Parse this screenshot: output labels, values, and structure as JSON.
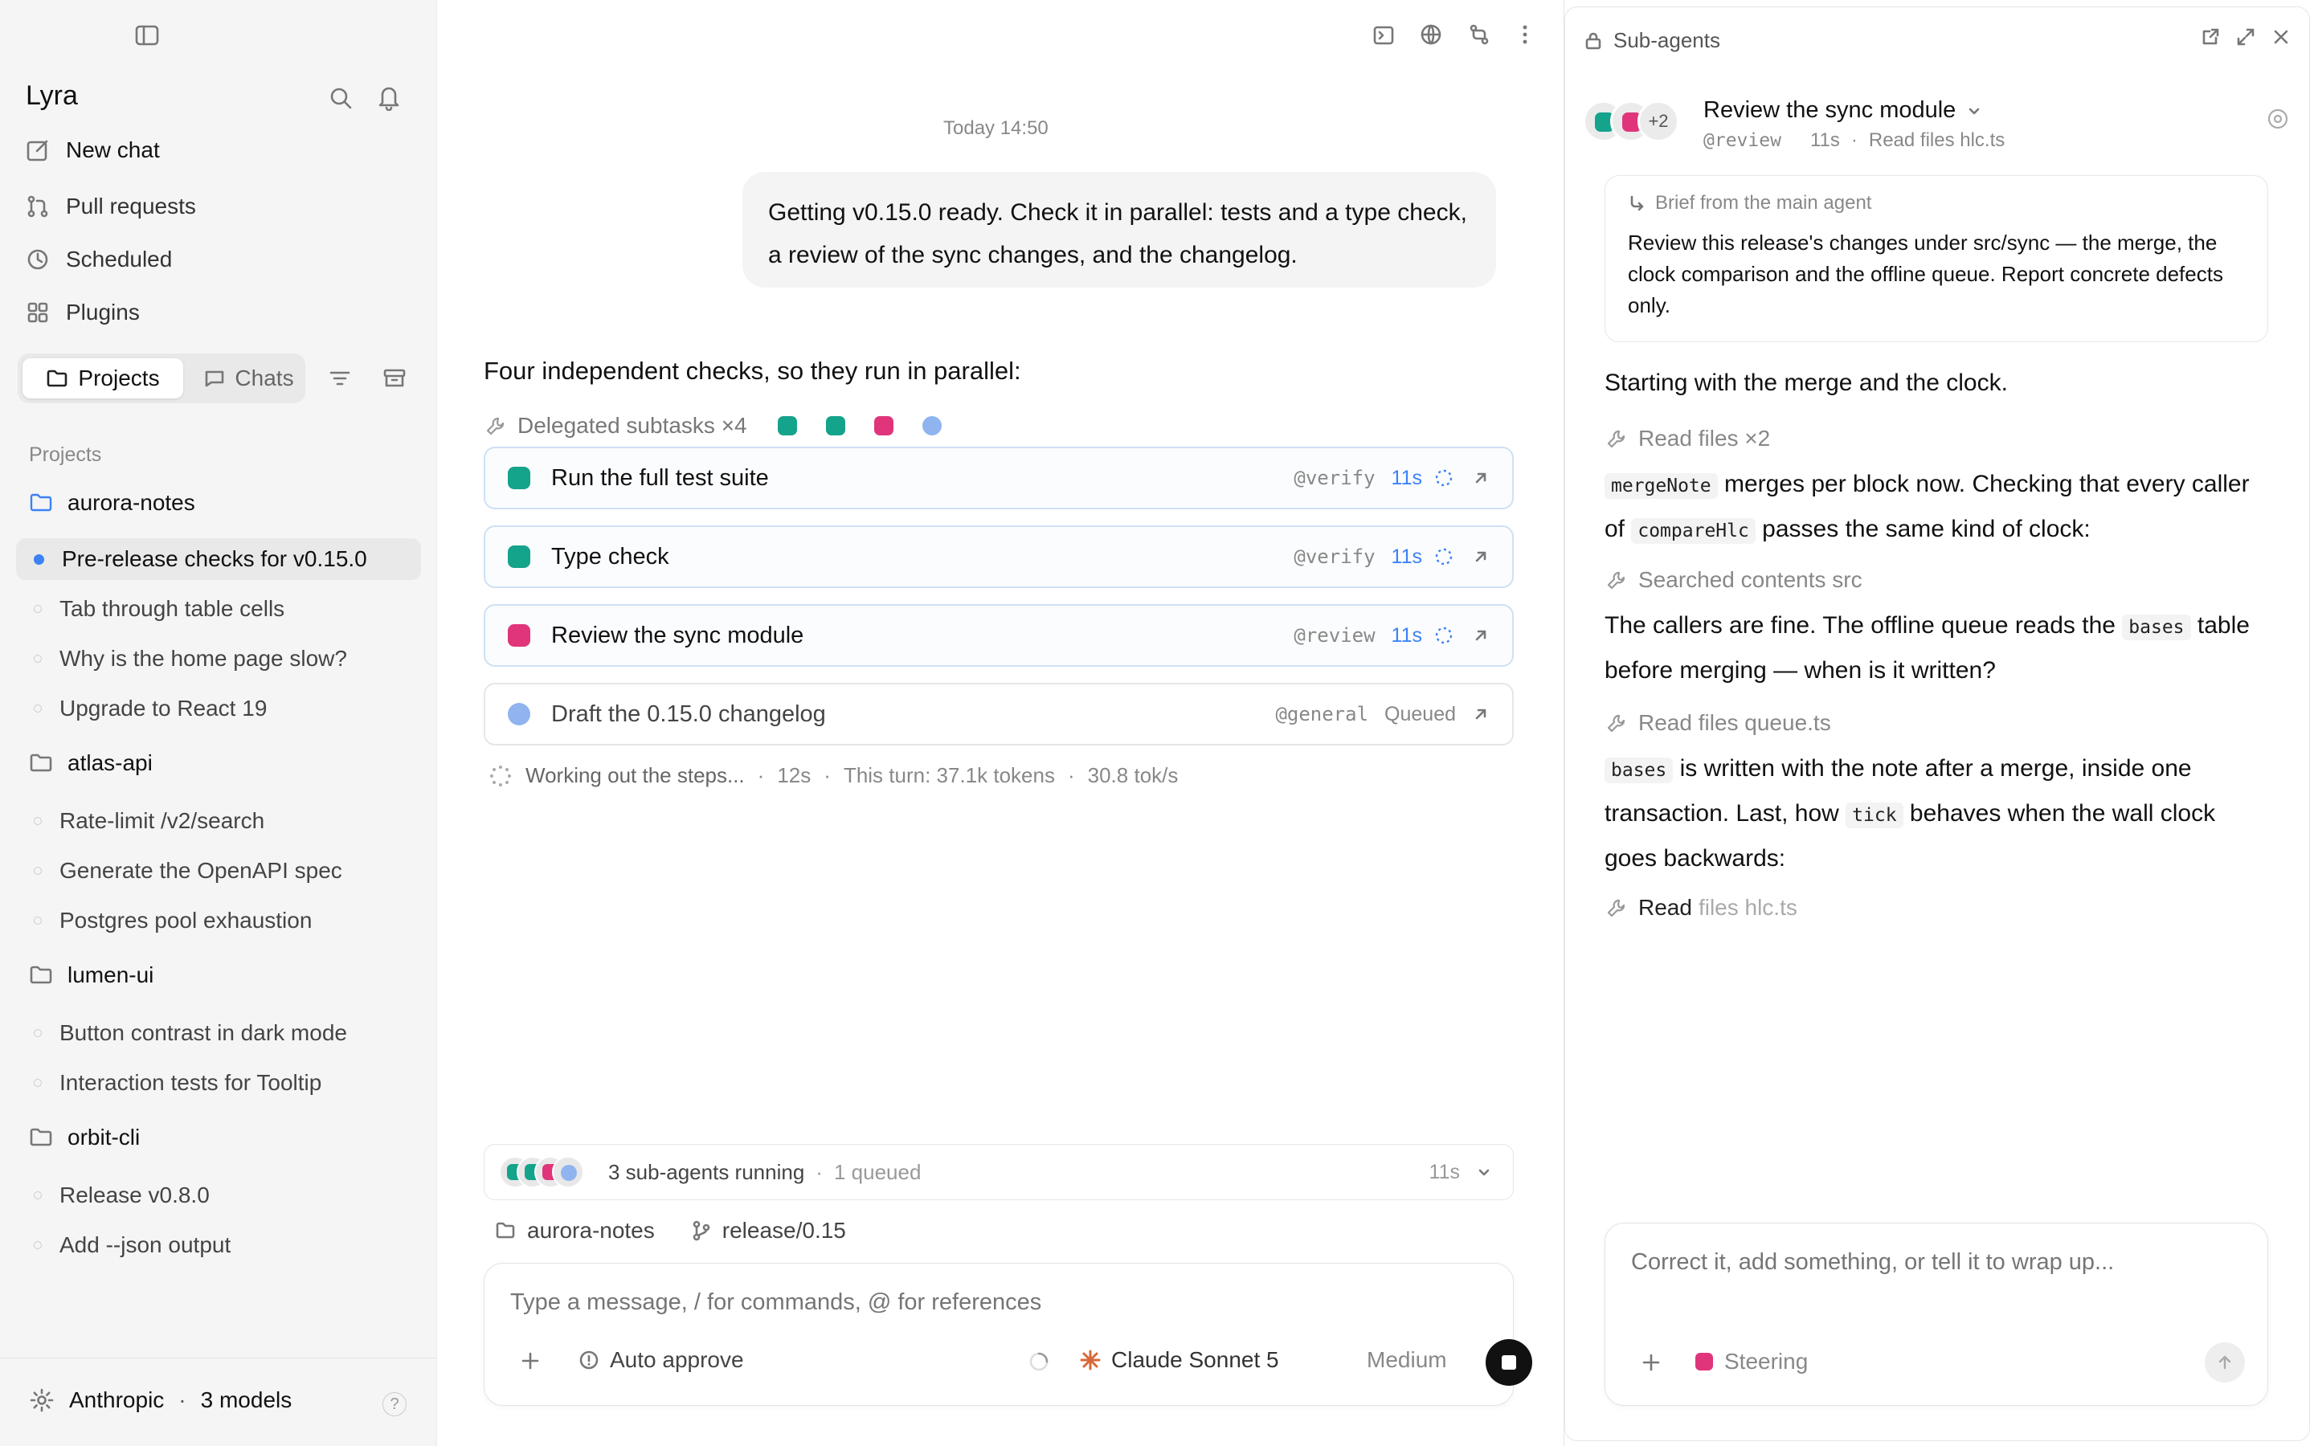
{
  "sidebar": {
    "brand": "Lyra",
    "nav": [
      {
        "label": "New chat",
        "icon": "edit-icon"
      },
      {
        "label": "Pull requests",
        "icon": "pull-request-icon"
      },
      {
        "label": "Scheduled",
        "icon": "clock-icon"
      },
      {
        "label": "Plugins",
        "icon": "plugins-icon"
      }
    ],
    "tabs": {
      "projects": "Projects",
      "chats": "Chats",
      "active": "Projects"
    },
    "section_label": "Projects",
    "projects": [
      {
        "name": "aurora-notes",
        "chats": [
          "Pre-release checks for v0.15.0",
          "Tab through table cells",
          "Why is the home page slow?",
          "Upgrade to React 19"
        ]
      },
      {
        "name": "atlas-api",
        "chats": [
          "Rate-limit /v2/search",
          "Generate the OpenAPI spec",
          "Postgres pool exhaustion"
        ]
      },
      {
        "name": "lumen-ui",
        "chats": [
          "Button contrast in dark mode",
          "Interaction tests for Tooltip"
        ]
      },
      {
        "name": "orbit-cli",
        "chats": [
          "Release v0.8.0",
          "Add --json output"
        ]
      }
    ],
    "active_chat": "Pre-release checks for v0.15.0",
    "footer": {
      "provider": "Anthropic",
      "models": "3 models",
      "help": "?"
    }
  },
  "center": {
    "timestamp": "Today 14:50",
    "user_message": "Getting v0.15.0 ready. Check it in parallel: tests and a type check, a review of the sync changes, and the changelog.",
    "assistant_lead": "Four independent checks, so they run in parallel:",
    "delegated_label": "Delegated subtasks ×4",
    "tasks": [
      {
        "title": "Run the full test suite",
        "agent": "@verify",
        "time": "11s",
        "status": "running",
        "color": "#14a38b"
      },
      {
        "title": "Type check",
        "agent": "@verify",
        "time": "11s",
        "status": "running",
        "color": "#14a38b"
      },
      {
        "title": "Review the sync module",
        "agent": "@review",
        "time": "11s",
        "status": "running",
        "color": "#e0357a"
      },
      {
        "title": "Draft the 0.15.0 changelog",
        "agent": "@general",
        "time": "Queued",
        "status": "queued",
        "color": "#8fb4f0"
      }
    ],
    "status": {
      "text": "Working out the steps...",
      "elapsed": "12s",
      "tokens": "This turn: 37.1k tokens",
      "rate": "30.8 tok/s"
    },
    "running_bar": {
      "running": "3 sub-agents running",
      "queued": "1 queued",
      "time": "11s"
    },
    "context": {
      "project": "aurora-notes",
      "branch": "release/0.15"
    },
    "composer": {
      "placeholder": "Type a message, / for commands, @ for references",
      "auto_approve": "Auto approve",
      "model": "Claude Sonnet 5",
      "effort": "Medium"
    }
  },
  "panel": {
    "title": "Sub-agents",
    "agent": {
      "name": "Review the sync module",
      "handle": "@review",
      "time": "11s",
      "activity": "Read files hlc.ts",
      "extra_count": "+2"
    },
    "brief_label": "Brief from the main agent",
    "brief": "Review this release's changes under src/sync — the merge, the clock comparison and the offline queue. Report concrete defects only.",
    "p1": "Starting with the merge and the clock.",
    "tool1": "Read files ×2",
    "p2_code1": "mergeNote",
    "p2_a": " merges per block now. Checking that every caller of ",
    "p2_code2": "compareHlc",
    "p2_b": " passes the same kind of clock:",
    "tool2": "Searched contents src",
    "p3_a": "The callers are fine. The offline queue reads the ",
    "p3_code": "bases",
    "p3_b": " table before merging — when is it written?",
    "tool3": "Read files queue.ts",
    "p4_code1": "bases",
    "p4_a": " is written with the note after a merge, inside one transaction. Last, how ",
    "p4_code2": "tick",
    "p4_b": " behaves when the wall clock goes backwards:",
    "tool4_verb": "Read",
    "tool4_rest": "files hlc.ts",
    "steer_placeholder": "Correct it, add something, or tell it to wrap up...",
    "steer_label": "Steering"
  },
  "colors": {
    "accent": "#3b82f6",
    "verify": "#14a38b",
    "review": "#e0357a",
    "general": "#8fb4f0",
    "claude": "#d9673a"
  }
}
